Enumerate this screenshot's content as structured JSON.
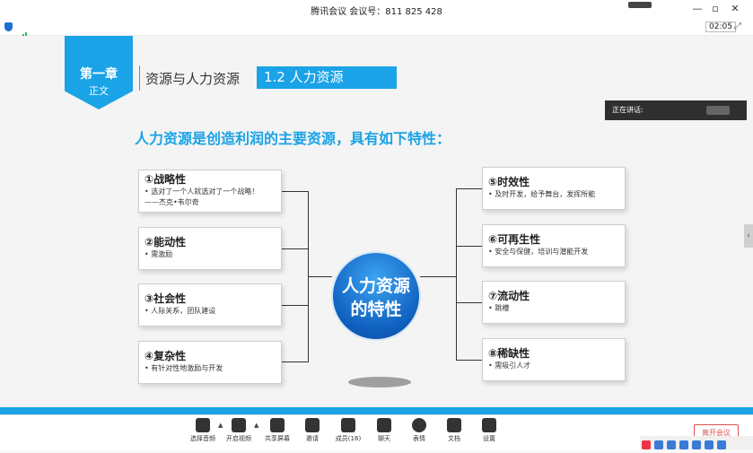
{
  "window": {
    "title": "腾讯会议 会议号：811 825 428",
    "minimize": "—",
    "restore": "▫",
    "close": "✕"
  },
  "toolbar": {
    "timer": "02:05",
    "expand_icon": "⤢"
  },
  "slide": {
    "chapter_title": "第一章",
    "chapter_sub": "正文",
    "section": "资源与人力资源",
    "subsection": "1.2  人力资源",
    "headline": "人力资源是创造利润的主要资源，具有如下特性：",
    "center": {
      "line1": "人力资源",
      "line2": "的特性"
    },
    "left_boxes": [
      {
        "title": "①战略性",
        "lines": [
          "•  选对了一个人就选对了一个战略！",
          "——杰克•韦尔奇"
        ]
      },
      {
        "title": "②能动性",
        "lines": [
          "•  需激励"
        ]
      },
      {
        "title": "③社会性",
        "lines": [
          "•  人际关系，团队建设"
        ]
      },
      {
        "title": "④复杂性",
        "lines": [
          "•  有针对性地激励与开发"
        ]
      }
    ],
    "right_boxes": [
      {
        "title": "⑤时效性",
        "lines": [
          "•  及时开发，给予舞台，发挥所能"
        ]
      },
      {
        "title": "⑥可再生性",
        "lines": [
          "•  安全与保健，培训与潜能开发"
        ]
      },
      {
        "title": "⑦流动性",
        "lines": [
          "•  跳槽"
        ]
      },
      {
        "title": "⑧稀缺性",
        "lines": [
          "•  需吸引人才"
        ]
      }
    ]
  },
  "speaker_panel": {
    "label": "正在讲话:"
  },
  "bottom_toolbar": {
    "items": [
      {
        "label": "选择音频",
        "icon": "headset-icon"
      },
      {
        "label": "开启视频",
        "icon": "camera-off-icon"
      },
      {
        "label": "共享屏幕",
        "icon": "share-screen-icon"
      },
      {
        "label": "邀请",
        "icon": "invite-icon"
      },
      {
        "label": "成员(16)",
        "icon": "members-icon"
      },
      {
        "label": "聊天",
        "icon": "chat-icon"
      },
      {
        "label": "表情",
        "icon": "emoji-icon"
      },
      {
        "label": "文档",
        "icon": "document-icon"
      },
      {
        "label": "设置",
        "icon": "settings-icon"
      }
    ],
    "leave": "离开会议"
  },
  "colors": {
    "accent": "#1aa3e6",
    "circle": "#1470d0",
    "dark_panel": "#2f2f2f"
  }
}
